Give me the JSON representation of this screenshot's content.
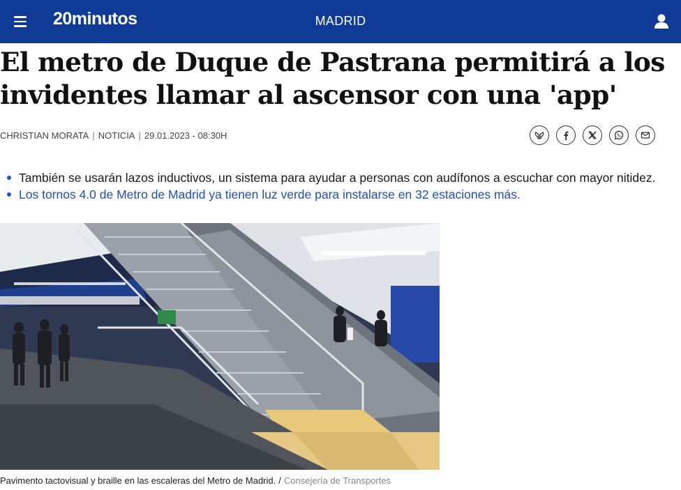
{
  "header": {
    "logo": "20minutos",
    "section": "MADRID",
    "menu_icon": "hamburger-menu-icon",
    "user_icon": "user-icon",
    "bg_color": "#0f3b96"
  },
  "article": {
    "headline": "El metro de Duque de Pastrana permitirá a los invidentes llamar al ascensor con una 'app'",
    "byline": {
      "author": "CHRISTIAN MORATA",
      "type": "NOTICIA",
      "datetime": "29.01.2023 - 08:30H"
    },
    "share_icons": [
      "bluesky-icon",
      "facebook-icon",
      "x-icon",
      "whatsapp-icon",
      "email-icon"
    ],
    "summary": [
      {
        "text": "También se usarán lazos inductivos, un sistema para ayudar a personas con audífonos a escuchar con mayor nitidez.",
        "link": false
      },
      {
        "text": "Los tornos 4.0 de Metro de Madrid ya tienen luz verde para instalarse en 32 estaciones más.",
        "link": true
      }
    ],
    "image": {
      "caption": "Pavimento tactovisual y braille en las escaleras del Metro de Madrid.",
      "credit": "Consejería de Transportes"
    }
  },
  "colors": {
    "accent": "#1f56c6",
    "link": "#1f4fb4"
  }
}
